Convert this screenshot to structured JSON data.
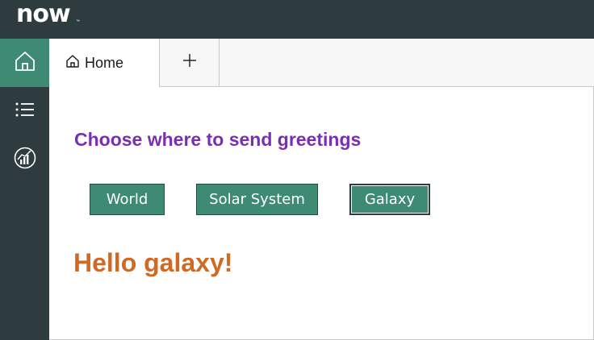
{
  "header": {
    "logo_text": "now",
    "logo_tm": "™"
  },
  "sidebar": {
    "items": [
      {
        "icon": "home-icon",
        "active": true
      },
      {
        "icon": "list-icon",
        "active": false
      },
      {
        "icon": "analytics-icon",
        "active": false
      }
    ]
  },
  "tabs": {
    "home_label": "Home",
    "add_label": "+"
  },
  "main": {
    "heading": "Choose where to send greetings",
    "buttons": [
      "World",
      "Solar System",
      "Galaxy"
    ],
    "selected_button": "Galaxy",
    "greeting": "Hello galaxy!"
  },
  "colors": {
    "topbar": "#2e3c40",
    "accent": "#3e8a72",
    "heading": "#7a2fb2",
    "greeting": "#cf6a25"
  }
}
